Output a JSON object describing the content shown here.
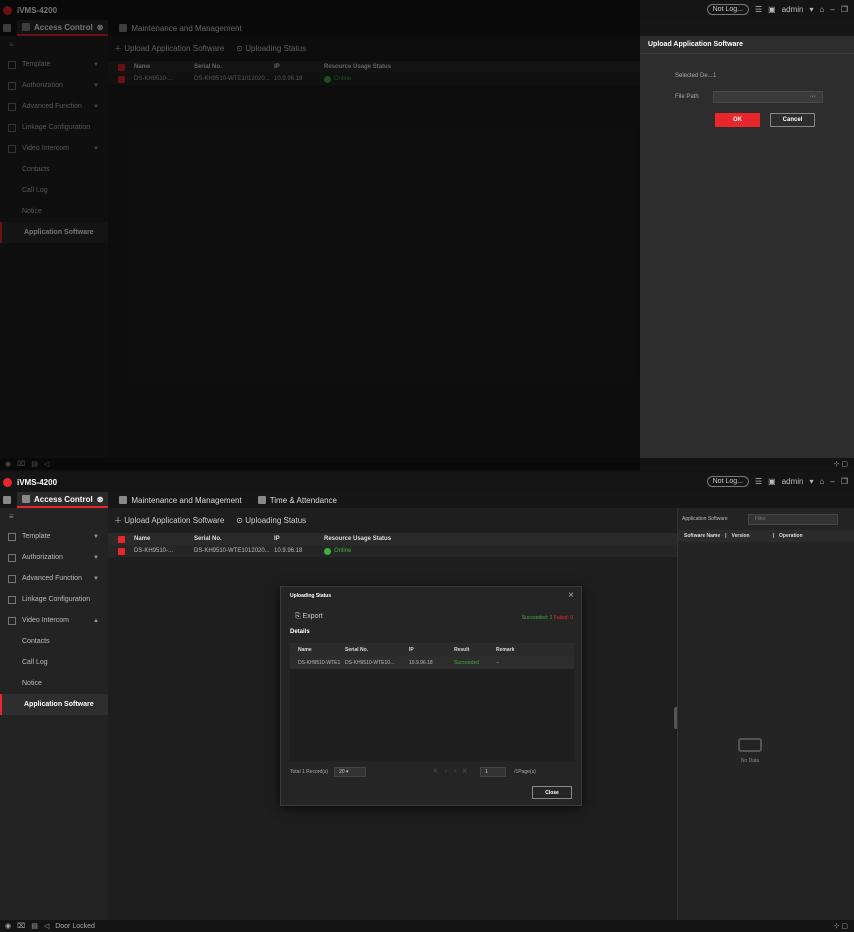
{
  "app": {
    "title": "iVMS-4200",
    "not_logged": "Not Log...",
    "user": "admin"
  },
  "shot1": {
    "tabs": [
      "Access Control",
      "Maintenance and Management"
    ],
    "toolbar": {
      "upload": "Upload Application Software",
      "status": "Uploading Status"
    },
    "table": {
      "headers": [
        "Name",
        "Serial No.",
        "IP",
        "Resource Usage Status"
      ],
      "row": {
        "name": "DS-KH9510-...",
        "serial": "DS-KH9510-WTE1012020...",
        "ip": "10.9.96.18",
        "status": "Online"
      }
    },
    "panel": {
      "title": "Upload Application Software",
      "selected_label": "Selected De...",
      "selected_value": "1",
      "file_label": "File Path",
      "file_value": "···",
      "ok": "OK",
      "cancel": "Cancel"
    }
  },
  "sidebar": {
    "items": [
      "Template",
      "Authorization",
      "Advanced Function",
      "Linkage Configuration",
      "Video Intercom"
    ],
    "subitems": [
      "Contacts",
      "Call Log",
      "Notice",
      "Application Software"
    ]
  },
  "shot2": {
    "tabs": [
      "Access Control",
      "Maintenance and Management",
      "Time & Attendance"
    ],
    "toolbar": {
      "upload": "Upload Application Software",
      "status": "Uploading Status"
    },
    "table": {
      "headers": [
        "Name",
        "Serial No.",
        "IP",
        "Resource Usage Status"
      ],
      "row": {
        "name": "DS-KH9510-...",
        "serial": "DS-KH9510-WTE1012020...",
        "ip": "10.9.96.18",
        "status": "Online"
      }
    },
    "right_panel": {
      "title": "Application Software",
      "filter_placeholder": "Filter",
      "headers": [
        "Software Name",
        "Version",
        "Operation"
      ],
      "empty": "No Data"
    },
    "modal": {
      "title": "Uploading Status",
      "export": "Export",
      "succeeded": "Succeeded: 1",
      "failed": "Failed: 0",
      "details": "Details",
      "headers": [
        "Name",
        "Serial No.",
        "IP",
        "Result",
        "Remark"
      ],
      "row": {
        "name": "DS-KH9510-WTE1",
        "serial": "DS-KH9510-WTE10...",
        "ip": "10.9.96.18",
        "result": "Succeeded",
        "remark": "--"
      },
      "total": "Total 1 Record(s)",
      "page_size": "20",
      "page": "1",
      "pages": "/1Page(s)",
      "close": "Close"
    },
    "status": "Door Locked"
  }
}
